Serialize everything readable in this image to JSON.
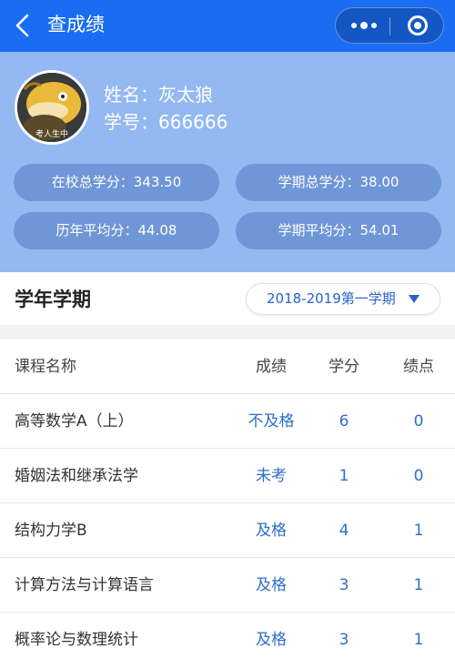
{
  "nav": {
    "title": "查成绩"
  },
  "profile": {
    "name": "姓名：灰太狼",
    "student_id": "学号：666666",
    "avatar_caption": "考人生中"
  },
  "stats": [
    {
      "label": "在校总学分：343.50"
    },
    {
      "label": "学期总学分：38.00"
    },
    {
      "label": "历年平均分：44.08"
    },
    {
      "label": "学期平均分：54.01"
    }
  ],
  "term": {
    "title": "学年学期",
    "selected": "2018-2019第一学期"
  },
  "table": {
    "headers": {
      "course": "课程名称",
      "grade": "成绩",
      "credit": "学分",
      "gpa": "绩点"
    },
    "rows": [
      {
        "course": "高等数学A（上）",
        "grade": "不及格",
        "credit": "6",
        "gpa": "0"
      },
      {
        "course": "婚姻法和继承法学",
        "grade": "未考",
        "credit": "1",
        "gpa": "0"
      },
      {
        "course": "结构力学B",
        "grade": "及格",
        "credit": "4",
        "gpa": "1"
      },
      {
        "course": "计算方法与计算语言",
        "grade": "及格",
        "credit": "3",
        "gpa": "1"
      },
      {
        "course": "概率论与数理统计",
        "grade": "及格",
        "credit": "3",
        "gpa": "1"
      }
    ]
  },
  "colors": {
    "navbar": "#1a6df2",
    "profile_bg": "#93b8f2",
    "stat_pill": "#6f96d6",
    "accent_text": "#2e6fc8"
  },
  "icons": [
    "back-icon",
    "more-icon",
    "target-icon",
    "caret-down-icon"
  ]
}
